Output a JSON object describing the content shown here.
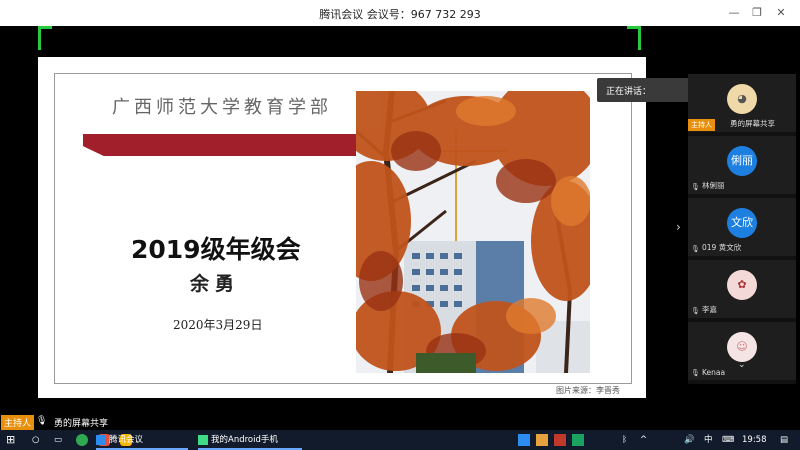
{
  "window": {
    "title": "腾讯会议  会议号：967 732 293",
    "controls": [
      "minimize-icon",
      "restore-icon",
      "close-icon"
    ]
  },
  "slide": {
    "school": "广西师范大学教育学部",
    "title": "2019级年级会",
    "author": "余勇",
    "date": "2020年3月29日",
    "photo_credit": "图片来源：李晋秀",
    "accent_color": "#a11f2a"
  },
  "subtitle_overlay": {
    "text": "正在讲话："
  },
  "participants": [
    {
      "name": "主持人",
      "avatar": "",
      "tag": "主持人",
      "label": "勇的屏幕共享"
    },
    {
      "name": "林俐丽",
      "avatar": "俐丽",
      "color": "#1d7fe0"
    },
    {
      "name": "019 黄文欣",
      "avatar": "文欣",
      "color": "#1d7fe0"
    },
    {
      "name": "李嘉",
      "avatar": "",
      "color": "#f4d9d9"
    },
    {
      "name": "Kenaa",
      "avatar": "",
      "color": "#f4e4e4"
    }
  ],
  "host_bar": {
    "badge": "主持人",
    "text": "勇的屏幕共享"
  },
  "taskbar": {
    "apps": [
      "腾讯会议",
      "我的Android手机"
    ],
    "ime": "中",
    "time": "19:58"
  }
}
